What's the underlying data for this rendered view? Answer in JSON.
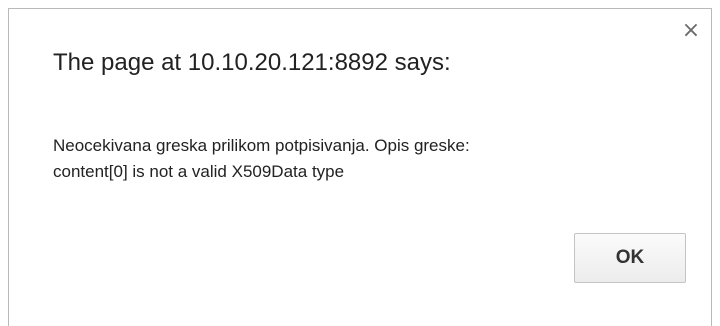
{
  "dialog": {
    "title": "The page at 10.10.20.121:8892 says:",
    "message_line1": "Neocekivana greska prilikom potpisivanja. Opis greske:",
    "message_line2": "content[0] is not a valid X509Data type",
    "close_glyph": "×",
    "ok_label": "OK"
  }
}
